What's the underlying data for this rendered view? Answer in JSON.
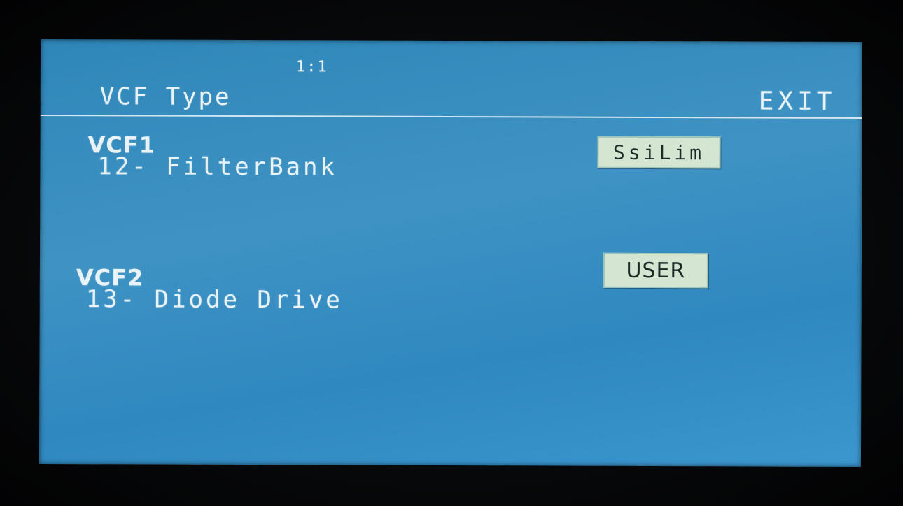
{
  "header": {
    "page_indicator": "1:1",
    "title": "VCF Type",
    "exit_label": "EXIT"
  },
  "vcf1": {
    "label": "VCF1",
    "filter": "12- FilterBank",
    "mode": "SsiLim"
  },
  "vcf2": {
    "label": "VCF2",
    "filter": "13- Diode Drive",
    "mode": "USER"
  },
  "colors": {
    "screen_background": "#3a8fc4",
    "text": "#e9f3f7",
    "button_background": "#d4e5d2"
  }
}
